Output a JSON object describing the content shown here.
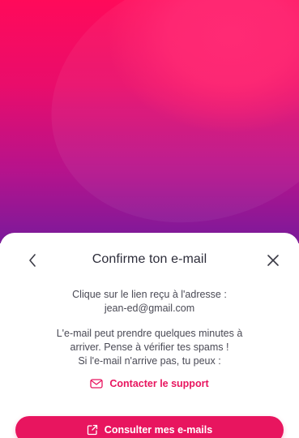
{
  "modal": {
    "title": "Confirme ton e-mail",
    "paragraph1": "Clique sur le lien reçu à l'adresse :",
    "email": "jean-ed@gmail.com",
    "paragraph2_line1": "L'e-mail peut prendre quelques minutes à",
    "paragraph2_line2": "arriver. Pense à vérifier tes spams !",
    "paragraph2_line3": "Si l'e-mail n'arrive pas, tu peux :",
    "support_link_label": "Contacter le support",
    "primary_button_label": "Consulter mes e-mails"
  },
  "icons": {
    "back": "chevron-left-icon",
    "close": "close-icon",
    "mail": "mail-icon",
    "external": "external-link-icon"
  },
  "colors": {
    "accent": "#e8155f",
    "gradient_top": "#ff0a5a",
    "gradient_bottom": "#7a1a9b",
    "text_primary": "#2d2d3a",
    "text_body": "#4a4a55"
  }
}
